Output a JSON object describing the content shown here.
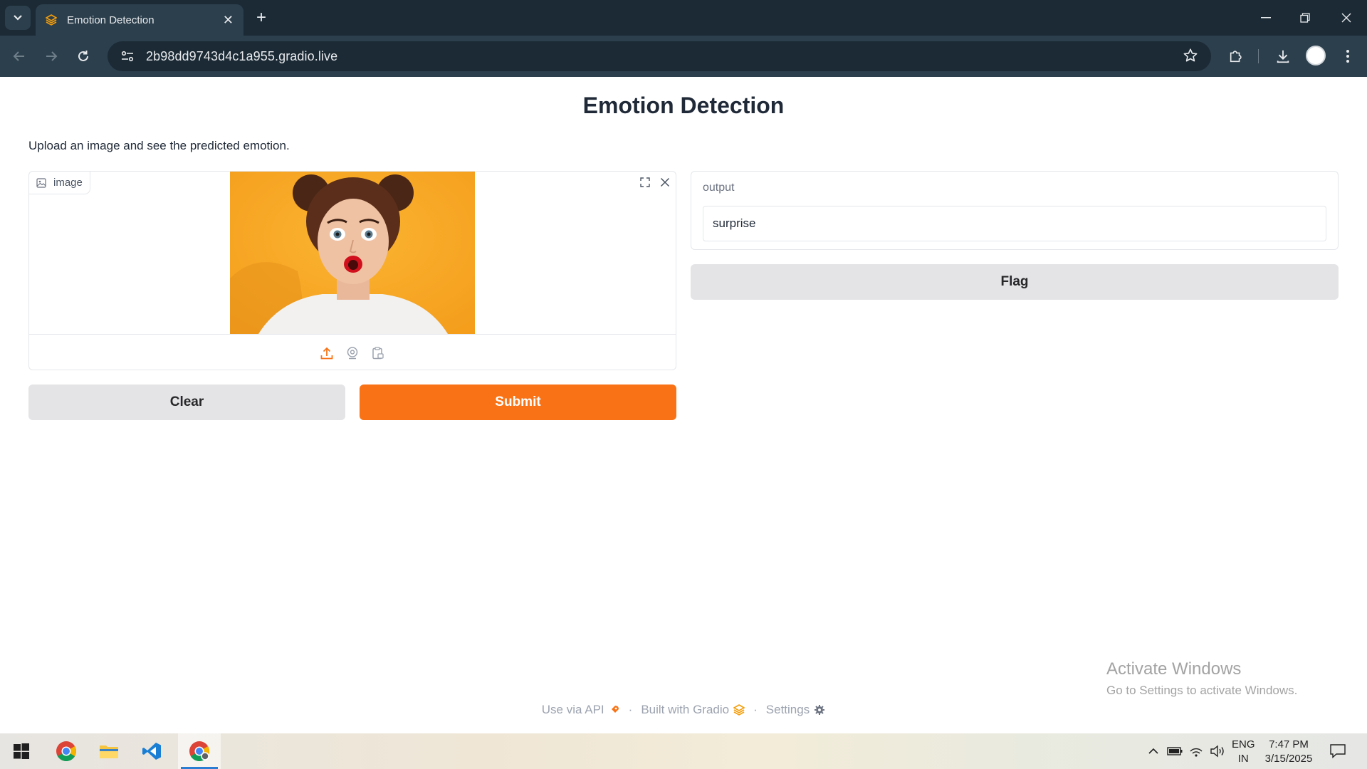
{
  "browser": {
    "tab_title": "Emotion Detection",
    "url": "2b98dd9743d4c1a955.gradio.live"
  },
  "page": {
    "title": "Emotion Detection",
    "description": "Upload an image and see the predicted emotion."
  },
  "input": {
    "label": "image"
  },
  "output": {
    "label": "output",
    "value": "surprise"
  },
  "buttons": {
    "clear": "Clear",
    "submit": "Submit",
    "flag": "Flag"
  },
  "footer": {
    "api": "Use via API",
    "built": "Built with Gradio",
    "settings": "Settings",
    "separator": "·"
  },
  "watermark": {
    "line1": "Activate Windows",
    "line2": "Go to Settings to activate Windows."
  },
  "taskbar": {
    "lang_line1": "ENG",
    "lang_line2": "IN",
    "time": "7:47 PM",
    "date": "3/15/2025",
    "apps": [
      "windows-start",
      "chrome",
      "file-explorer",
      "vscode",
      "chrome-canary"
    ]
  },
  "colors": {
    "accent": "#f97316",
    "secondary_button": "#e4e4e7",
    "browser_frame": "#1b2a35",
    "browser_toolbar": "#2c3f4c"
  }
}
